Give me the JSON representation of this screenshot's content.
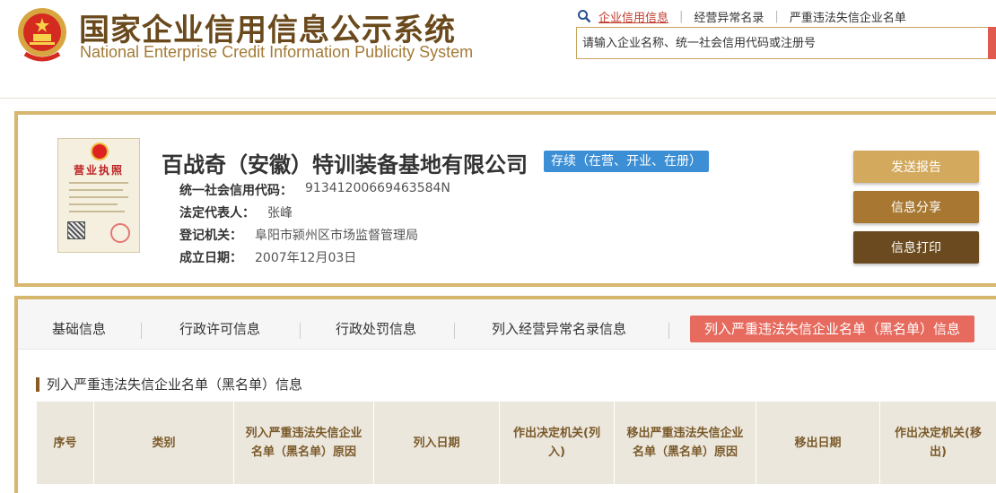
{
  "header": {
    "title_cn": "国家企业信用信息公示系统",
    "title_en": "National Enterprise Credit Information Publicity System",
    "links": [
      "企业信用信息",
      "经营异常名录",
      "严重违法失信企业名单"
    ],
    "search_placeholder": "请输入企业名称、统一社会信用代码或注册号"
  },
  "company": {
    "license_title": "营业执照",
    "name": "百战奇（安徽）特训装备基地有限公司",
    "status": "存续（在营、开业、在册）",
    "fields": [
      {
        "label": "统一社会信用代码：",
        "value": "91341200669463584N"
      },
      {
        "label": "法定代表人：",
        "value": "张峰"
      },
      {
        "label": "登记机关：",
        "value": "阜阳市颍州区市场监督管理局"
      },
      {
        "label": "成立日期：",
        "value": "2007年12月03日"
      }
    ],
    "actions": {
      "report": "发送报告",
      "share": "信息分享",
      "print": "信息打印"
    }
  },
  "tabs": [
    "基础信息",
    "行政许可信息",
    "行政处罚信息",
    "列入经营异常名录信息",
    "列入严重违法失信企业名单（黑名单）信息"
  ],
  "active_tab": 4,
  "section": {
    "title": "列入严重违法失信企业名单（黑名单）信息",
    "columns": [
      "序号",
      "类别",
      "列入严重违法失信企业名单（黑名单）原因",
      "列入日期",
      "作出决定机关(列入)",
      "移出严重违法失信企业名单（黑名单）原因",
      "移出日期",
      "作出决定机关(移出)"
    ]
  },
  "colors": {
    "brand_brown": "#6a4a1c",
    "gold_border": "#d7b66e",
    "status_blue": "#3c8fd5",
    "active_tab_red": "#e76a5e"
  }
}
